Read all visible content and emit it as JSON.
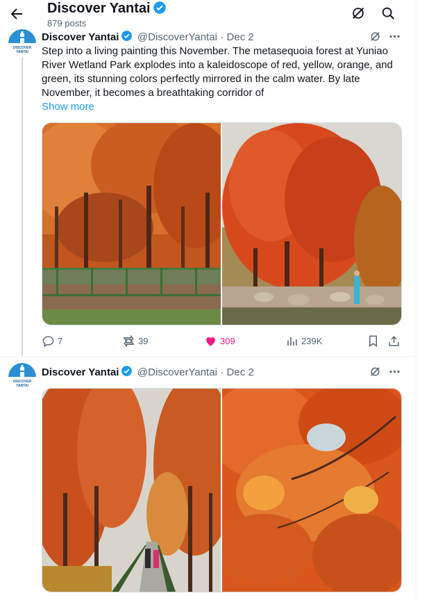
{
  "header": {
    "title": "Discover Yantai",
    "post_count": "879 posts"
  },
  "avatar_text": "DISCOVER YANTAI",
  "tweets": [
    {
      "name": "Discover Yantai",
      "handle": "@DiscoverYantai",
      "date": "· Dec 2",
      "text": "Step into a living painting this November. The metasequoia forest at Yuniao River Wetland Park explodes into a kaleidoscope of red, yellow, orange, and green, its stunning colors perfectly mirrored in the calm water. By late November, it becomes a breathtaking corridor of",
      "show_more": "Show more",
      "replies": "7",
      "reposts": "39",
      "likes": "309",
      "views": "239K"
    },
    {
      "name": "Discover Yantai",
      "handle": "@DiscoverYantai",
      "date": "· Dec 2"
    }
  ],
  "colors": {
    "accent": "#1d9bf0",
    "like": "#f91880",
    "muted": "#536471"
  },
  "icons": [
    "back-arrow-icon",
    "verified-badge-icon",
    "grok-icon",
    "search-icon",
    "more-icon",
    "reply-icon",
    "repost-icon",
    "like-icon",
    "views-icon",
    "bookmark-icon",
    "share-icon"
  ]
}
